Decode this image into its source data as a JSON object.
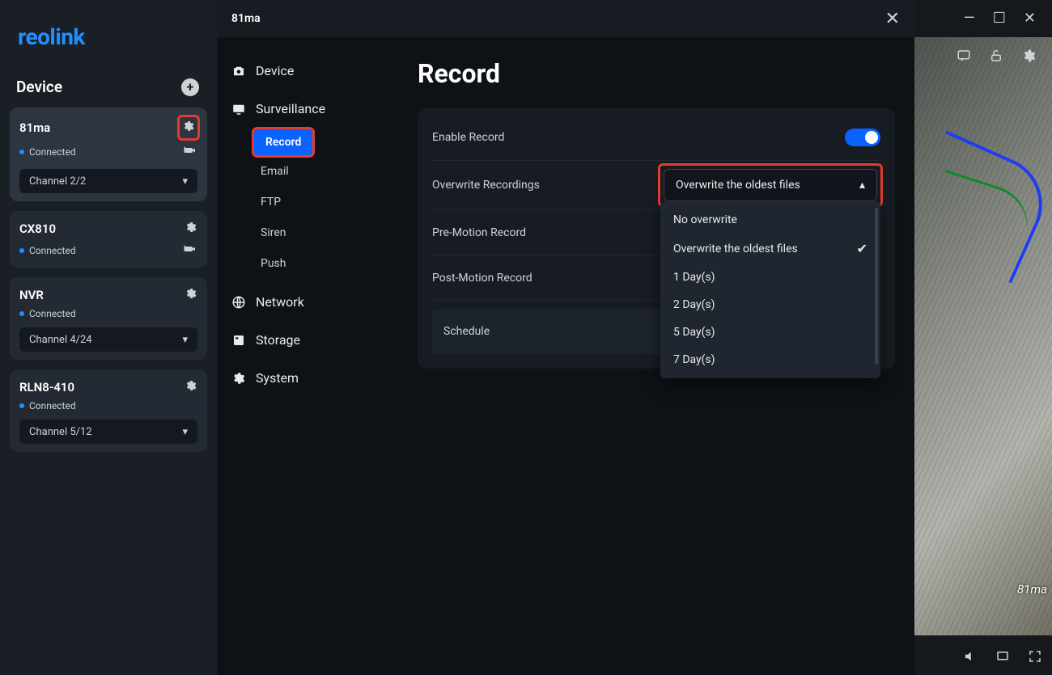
{
  "brand": "reolink",
  "sidebar": {
    "header": "Device",
    "devices": [
      {
        "name": "81ma",
        "status": "Connected",
        "channel": "Channel 2/2",
        "has_cam_icon": true,
        "active": true,
        "gear_highlight": true
      },
      {
        "name": "CX810",
        "status": "Connected",
        "channel": null,
        "has_cam_icon": true,
        "active": false
      },
      {
        "name": "NVR",
        "status": "Connected",
        "channel": "Channel 4/24",
        "has_cam_icon": false,
        "active": false
      },
      {
        "name": "RLN8-410",
        "status": "Connected",
        "channel": "Channel 5/12",
        "has_cam_icon": false,
        "active": false
      }
    ]
  },
  "settings": {
    "device_title": "81ma",
    "nav": {
      "device": "Device",
      "surveillance": "Surveillance",
      "surveillance_items": [
        "Record",
        "Email",
        "FTP",
        "Siren",
        "Push"
      ],
      "network": "Network",
      "storage": "Storage",
      "system": "System"
    },
    "page_title": "Record",
    "rows": {
      "enable_record": "Enable Record",
      "overwrite": "Overwrite Recordings",
      "pre_motion": "Pre-Motion Record",
      "post_motion": "Post-Motion Record",
      "schedule": "Schedule"
    },
    "overwrite_dropdown": {
      "selected": "Overwrite the oldest files",
      "options": [
        "No overwrite",
        "Overwrite the oldest files",
        "1 Day(s)",
        "2 Day(s)",
        "5 Day(s)",
        "7 Day(s)"
      ]
    }
  },
  "camera_feed_label": "81ma",
  "colors": {
    "accent": "#0a63ff",
    "highlight": "#e53b2e"
  }
}
